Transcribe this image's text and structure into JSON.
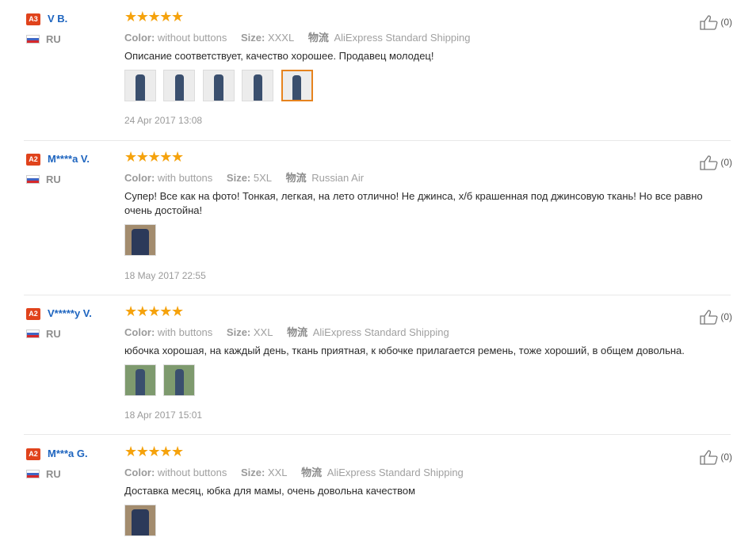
{
  "labels": {
    "color": "Color:",
    "size": "Size:",
    "shipping": "物流"
  },
  "reviews": [
    {
      "badge": "A3",
      "name": "V B.",
      "country": "RU",
      "stars": "★★★★★",
      "color": "without buttons",
      "size": "XXXL",
      "shipping": "AliExpress Standard Shipping",
      "text": "Описание соответствует, качество хорошее. Продавец молодец!",
      "thumbnails": 5,
      "date": "24 Apr 2017 13:08",
      "helpful": "(0)"
    },
    {
      "badge": "A2",
      "name": "M****a V.",
      "country": "RU",
      "stars": "★★★★★",
      "color": "with buttons",
      "size": "5XL",
      "shipping": "Russian Air",
      "text": "Супер! Все как на фото! Тонкая, легкая, на лето отлично! Не джинса, х/б крашенная под джинсовую ткань! Но все равно очень достойна!",
      "thumbnails": 1,
      "date": "18 May 2017 22:55",
      "helpful": "(0)"
    },
    {
      "badge": "A2",
      "name": "V*****y V.",
      "country": "RU",
      "stars": "★★★★★",
      "color": "with buttons",
      "size": "XXL",
      "shipping": "AliExpress Standard Shipping",
      "text": "юбочка хорошая, на каждый день, ткань приятная, к юбочке прилагается ремень, тоже хороший, в общем довольна.",
      "thumbnails": 2,
      "date": "18 Apr 2017 15:01",
      "helpful": "(0)"
    },
    {
      "badge": "A2",
      "name": "M***a G.",
      "country": "RU",
      "stars": "★★★★★",
      "color": "without buttons",
      "size": "XXL",
      "shipping": "AliExpress Standard Shipping",
      "text": "Доставка месяц, юбка для мамы, очень довольна качеством",
      "thumbnails": 1,
      "date": "",
      "helpful": "(0)"
    }
  ],
  "colors": {
    "badge": "#e0431c",
    "name": "#1d64bf",
    "stars": "#f5a20c",
    "selected_thumb": "#e6831e"
  },
  "icons": {
    "helpful": "thumbs-up-icon",
    "flag": "russia-flag-icon"
  }
}
